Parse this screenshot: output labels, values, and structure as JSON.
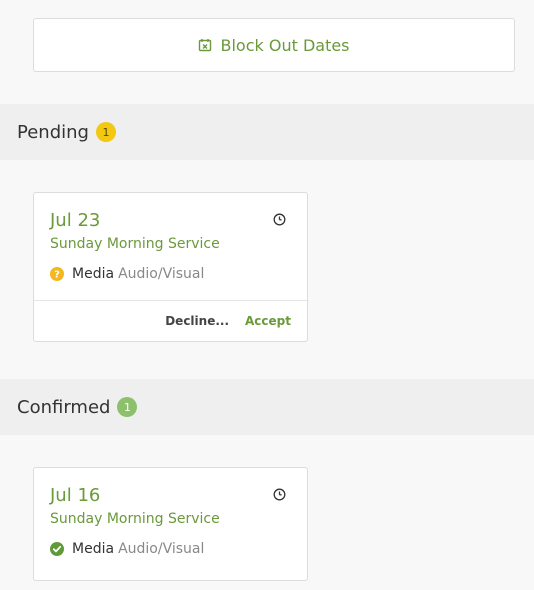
{
  "block_out": {
    "label": "Block Out Dates",
    "icon": "calendar-x-icon"
  },
  "pending": {
    "title": "Pending",
    "count": "1",
    "card": {
      "date": "Jul 23",
      "service": "Sunday Morning Service",
      "team": "Media",
      "position": "Audio/Visual",
      "status_icon": "question-icon",
      "decline_label": "Decline...",
      "accept_label": "Accept"
    }
  },
  "confirmed": {
    "title": "Confirmed",
    "count": "1",
    "card": {
      "date": "Jul 16",
      "service": "Sunday Morning Service",
      "team": "Media",
      "position": "Audio/Visual",
      "status_icon": "check-icon"
    }
  },
  "colors": {
    "accent": "#6a9a3a",
    "pending_badge": "#f2c811",
    "confirmed_badge": "#8dc06c"
  }
}
